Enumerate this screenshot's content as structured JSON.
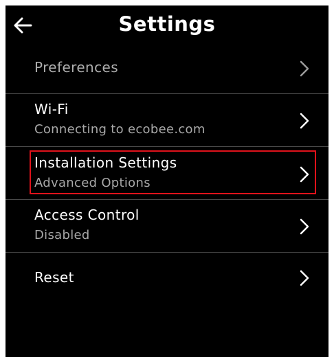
{
  "header": {
    "title": "Settings",
    "back_icon": "back-arrow-icon"
  },
  "menu": {
    "items": [
      {
        "label": "Preferences",
        "sublabel": "",
        "icon": "chevron-right-icon"
      },
      {
        "label": "Wi-Fi",
        "sublabel": "Connecting to ecobee.com",
        "icon": "chevron-right-icon"
      },
      {
        "label": "Installation Settings",
        "sublabel": "Advanced Options",
        "icon": "chevron-right-icon",
        "highlighted": true
      },
      {
        "label": "Access Control",
        "sublabel": "Disabled",
        "icon": "chevron-right-icon"
      },
      {
        "label": "Reset",
        "sublabel": "",
        "icon": "chevron-right-icon"
      }
    ]
  },
  "colors": {
    "background": "#000000",
    "text": "#ffffff",
    "subtext": "#a8a8a8",
    "divider": "#4a4a4a",
    "highlight": "#e0121b"
  }
}
